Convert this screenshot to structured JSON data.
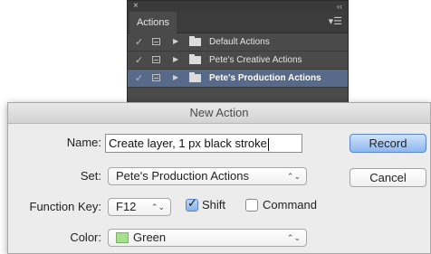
{
  "actions_panel": {
    "close_glyph": "×",
    "collapse_glyph": "‹‹",
    "tab_label": "Actions",
    "menu_glyph": "▾☰",
    "rows": [
      {
        "label": "Default Actions",
        "selected": false
      },
      {
        "label": "Pete's Creative Actions",
        "selected": false
      },
      {
        "label": "Pete's Production Actions",
        "selected": true
      }
    ],
    "check_glyph": "✓",
    "triangle_glyph": "▶",
    "selection_color": "#586a8a"
  },
  "dialog": {
    "title": "New Action",
    "name_label": "Name:",
    "name_value": "Create layer, 1 px black stroke",
    "set_label": "Set:",
    "set_value": "Pete's Production Actions",
    "function_key_label": "Function Key:",
    "function_key_value": "F12",
    "shift_label": "Shift",
    "shift_checked": true,
    "command_label": "Command",
    "command_checked": false,
    "color_label": "Color:",
    "color_value": "Green",
    "color_swatch": "#a6e08c",
    "record_label": "Record",
    "cancel_label": "Cancel",
    "popup_arrows": "⌃⌄",
    "checkmark": "✓",
    "accent": "#8db7f0"
  }
}
